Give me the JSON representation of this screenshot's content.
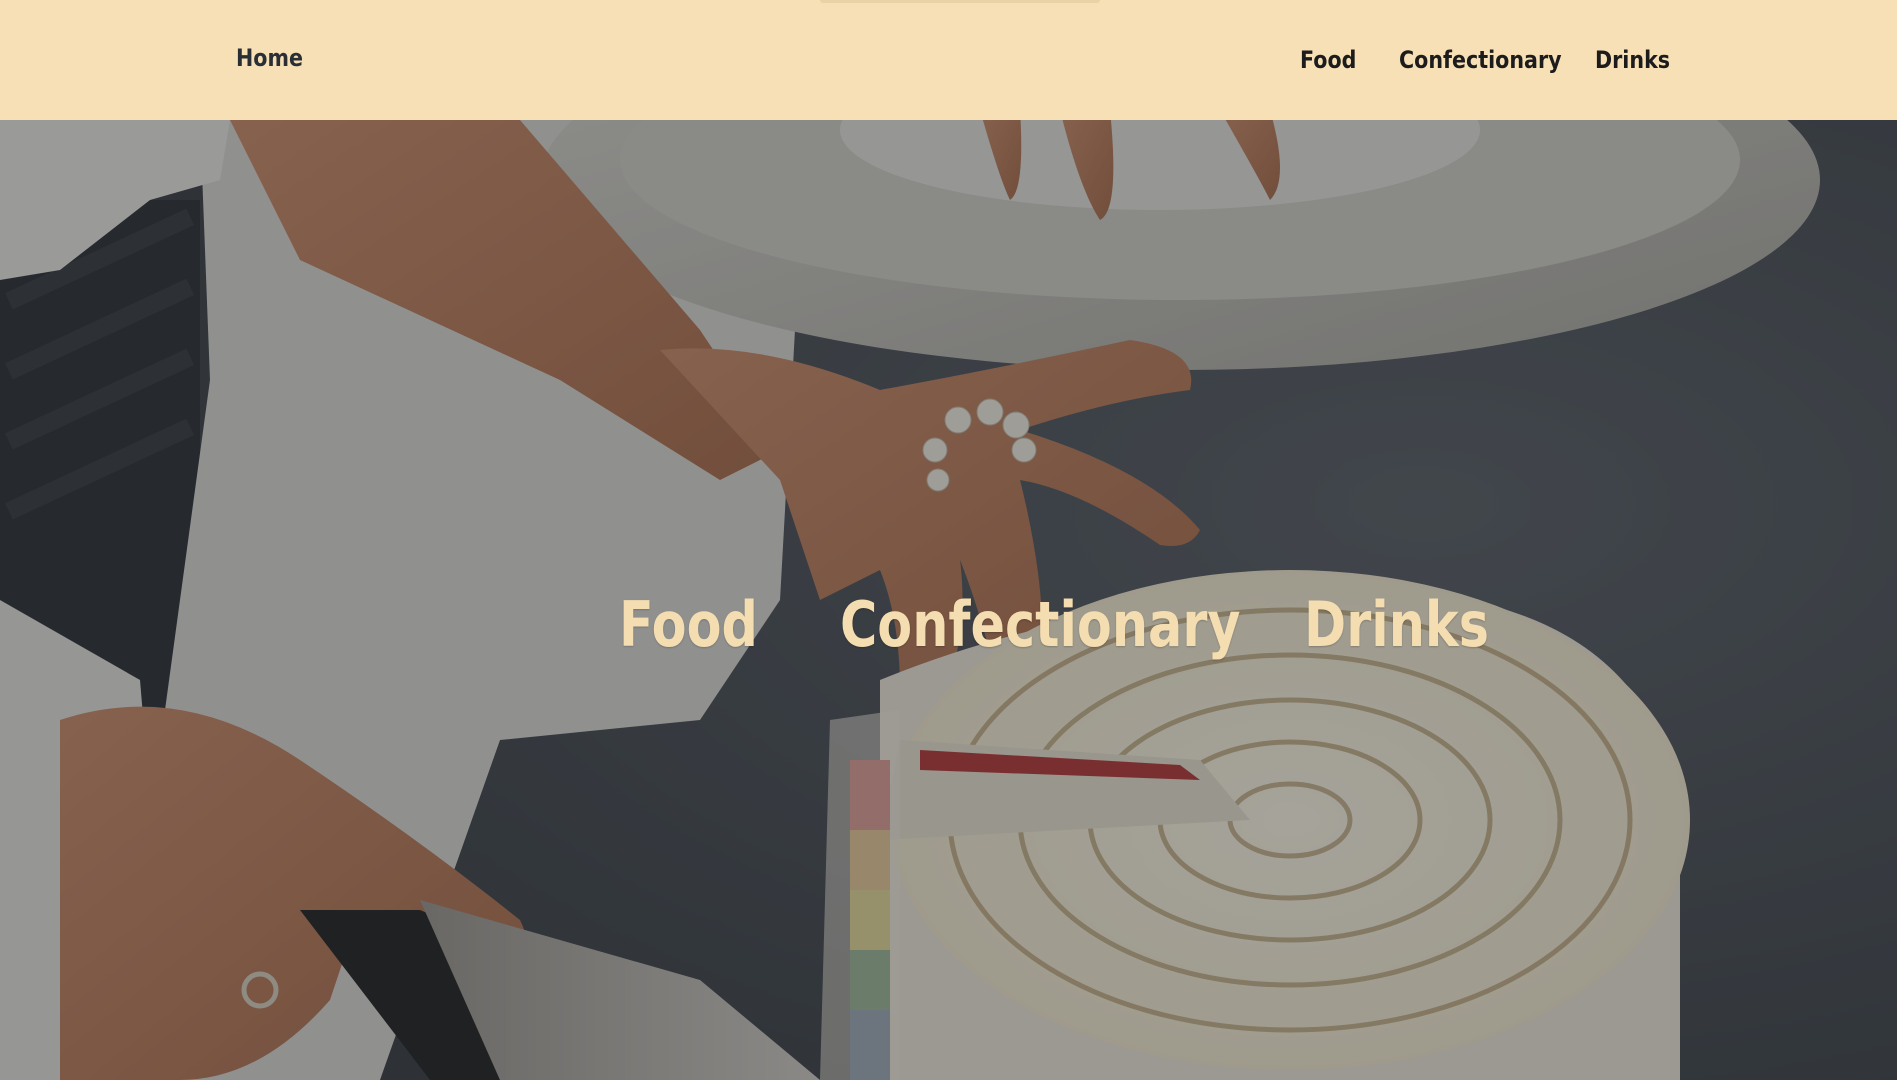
{
  "nav": {
    "home_label": "Home",
    "links": [
      {
        "label": "Food"
      },
      {
        "label": "Confectionary"
      },
      {
        "label": "Drinks"
      }
    ]
  },
  "hero": {
    "links": [
      {
        "label": "Food"
      },
      {
        "label": "Confectionary"
      },
      {
        "label": "Drinks"
      }
    ],
    "background_description_icon": "cake-cutting-photo"
  },
  "colors": {
    "navbar_bg": "#f7e0b5",
    "nav_text": "#1c1c1c",
    "hero_text": "#f4ddb0",
    "overlay": "#191c20"
  }
}
